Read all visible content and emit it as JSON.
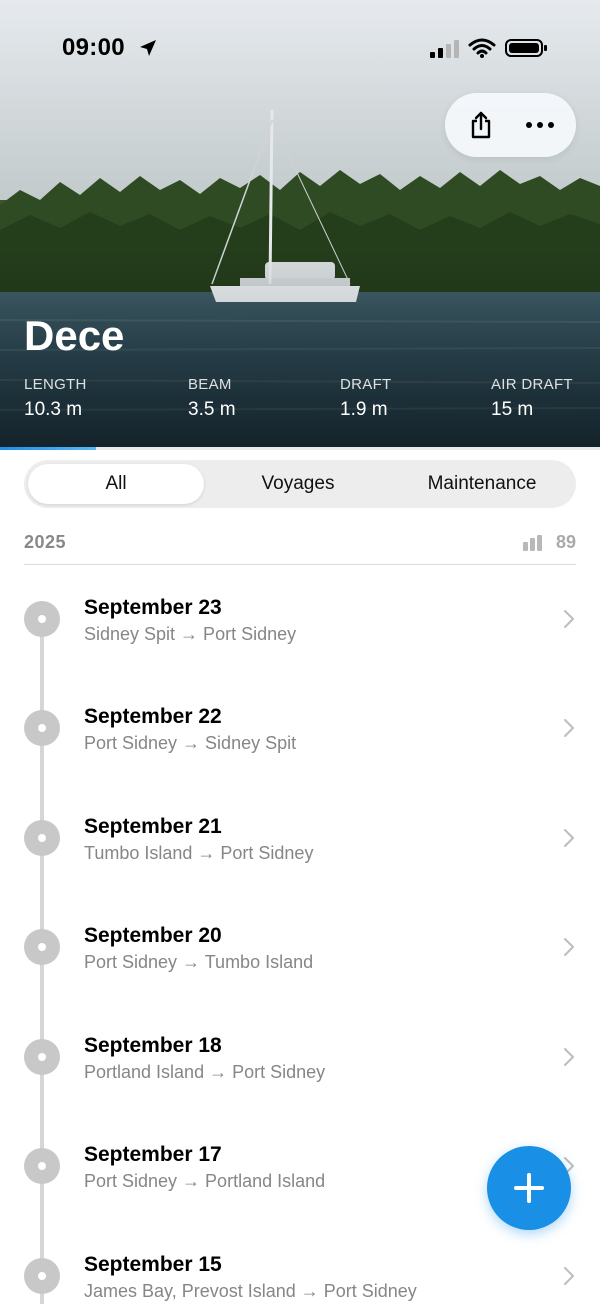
{
  "status_bar": {
    "time": "09:00"
  },
  "boat": {
    "name": "Dece",
    "dimensions": [
      {
        "label": "LENGTH",
        "value": "10.3 m"
      },
      {
        "label": "BEAM",
        "value": "3.5 m"
      },
      {
        "label": "DRAFT",
        "value": "1.9 m"
      },
      {
        "label": "AIR DRAFT",
        "value": "15 m"
      }
    ]
  },
  "header_actions": {
    "share_icon": "share-icon",
    "more_icon": "more-icon"
  },
  "progress": {
    "fraction": 0.16
  },
  "tabs": [
    {
      "label": "All",
      "active": true
    },
    {
      "label": "Voyages",
      "active": false
    },
    {
      "label": "Maintenance",
      "active": false
    }
  ],
  "year_section": {
    "year": "2025",
    "count": "89",
    "icon": "bar-chart-icon"
  },
  "entries": [
    {
      "date": "September 23",
      "route": "Sidney Spit → Port Sidney"
    },
    {
      "date": "September 22",
      "route": "Port Sidney → Sidney Spit"
    },
    {
      "date": "September 21",
      "route": "Tumbo Island → Port Sidney"
    },
    {
      "date": "September 20",
      "route": "Port Sidney → Tumbo Island"
    },
    {
      "date": "September 18",
      "route": "Portland Island → Port Sidney"
    },
    {
      "date": "September 17",
      "route": "Port Sidney → Portland Island"
    },
    {
      "date": "September 15",
      "route": "James Bay, Prevost Island → Port Sidney"
    }
  ],
  "fab": {
    "icon": "plus-icon"
  },
  "colors": {
    "accent": "#1a8fe6",
    "node": "#c8c8c8"
  }
}
